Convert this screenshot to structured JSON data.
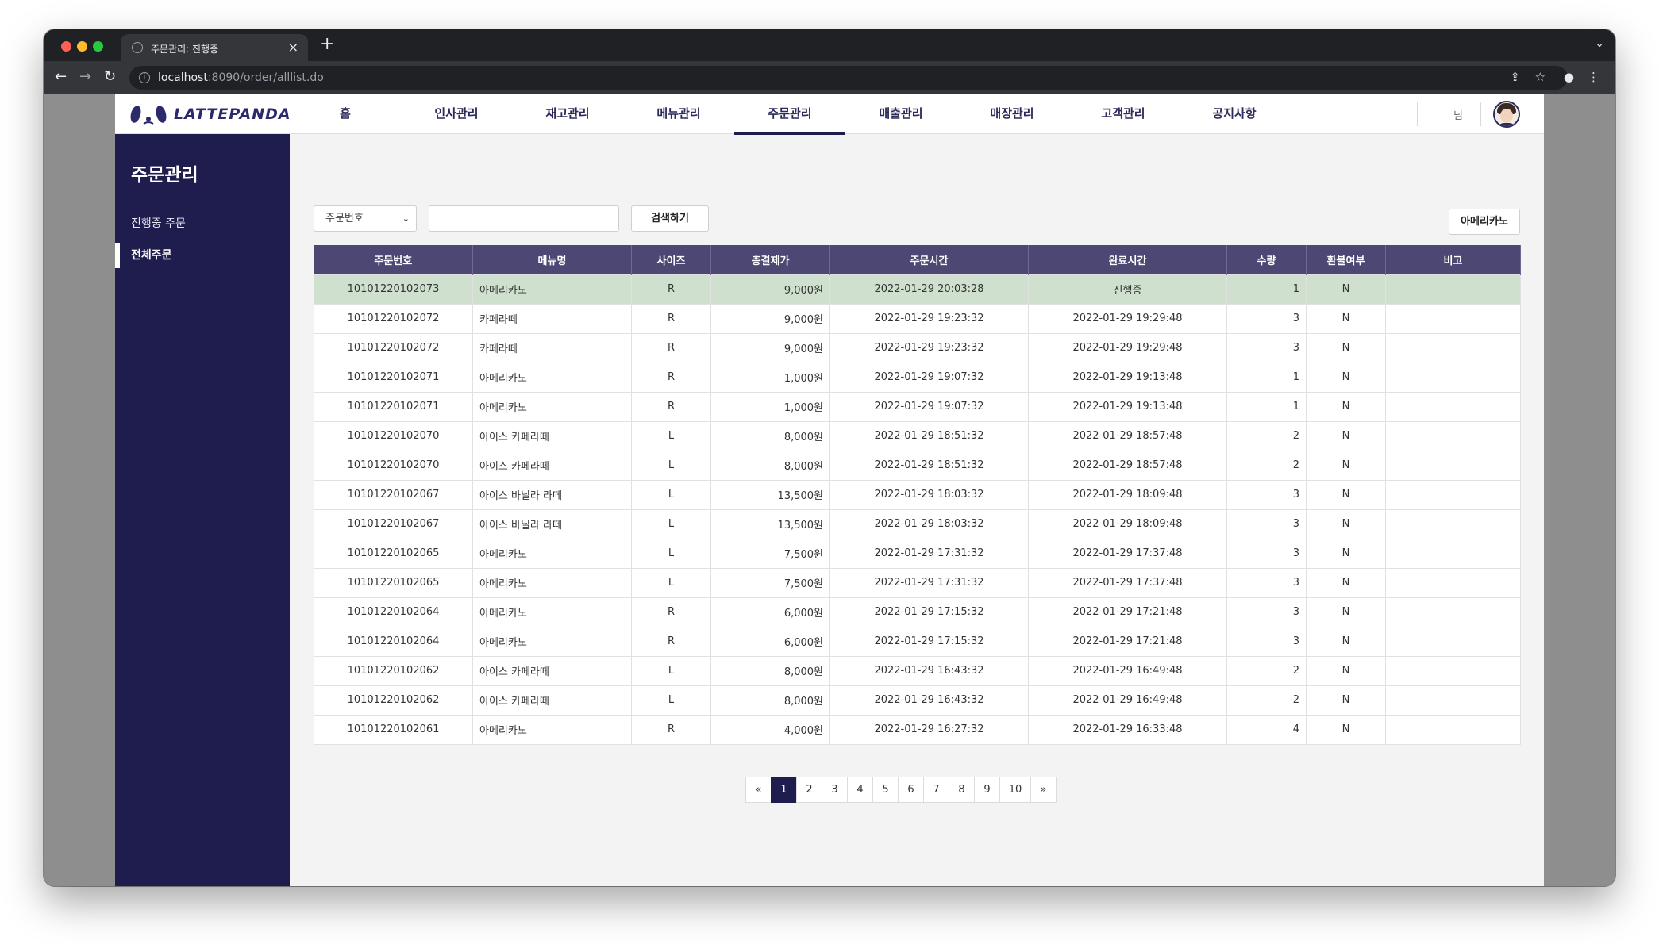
{
  "browser": {
    "tab_title": "주문관리: 진행중",
    "url_host": "localhost",
    "url_rest": ":8090/order/alllist.do"
  },
  "header": {
    "logo_text": "LATTEPANDA",
    "nav": [
      "홈",
      "인사관리",
      "재고관리",
      "메뉴관리",
      "주문관리",
      "매출관리",
      "매장관리",
      "고객관리",
      "공지사항"
    ],
    "active_nav": "주문관리",
    "user_suffix": "님"
  },
  "sidebar": {
    "title": "주문관리",
    "items": [
      "진행중 주문",
      "전체주문"
    ],
    "active_item": "전체주문"
  },
  "search": {
    "select_value": "주문번호",
    "input_value": "",
    "search_button": "검색하기",
    "filter_button": "아메리카노"
  },
  "table": {
    "headers": [
      "주문번호",
      "메뉴명",
      "사이즈",
      "총결제가",
      "주문시간",
      "완료시간",
      "수량",
      "환불여부",
      "비고"
    ],
    "rows": [
      [
        "10101220102073",
        "아메리카노",
        "R",
        "9,000원",
        "2022-01-29 20:03:28",
        "진행중",
        "1",
        "N",
        ""
      ],
      [
        "10101220102072",
        "카페라떼",
        "R",
        "9,000원",
        "2022-01-29 19:23:32",
        "2022-01-29 19:29:48",
        "3",
        "N",
        ""
      ],
      [
        "10101220102072",
        "카페라떼",
        "R",
        "9,000원",
        "2022-01-29 19:23:32",
        "2022-01-29 19:29:48",
        "3",
        "N",
        ""
      ],
      [
        "10101220102071",
        "아메리카노",
        "R",
        "1,000원",
        "2022-01-29 19:07:32",
        "2022-01-29 19:13:48",
        "1",
        "N",
        ""
      ],
      [
        "10101220102071",
        "아메리카노",
        "R",
        "1,000원",
        "2022-01-29 19:07:32",
        "2022-01-29 19:13:48",
        "1",
        "N",
        ""
      ],
      [
        "10101220102070",
        "아이스 카페라떼",
        "L",
        "8,000원",
        "2022-01-29 18:51:32",
        "2022-01-29 18:57:48",
        "2",
        "N",
        ""
      ],
      [
        "10101220102070",
        "아이스 카페라떼",
        "L",
        "8,000원",
        "2022-01-29 18:51:32",
        "2022-01-29 18:57:48",
        "2",
        "N",
        ""
      ],
      [
        "10101220102067",
        "아이스 바닐라 라떼",
        "L",
        "13,500원",
        "2022-01-29 18:03:32",
        "2022-01-29 18:09:48",
        "3",
        "N",
        ""
      ],
      [
        "10101220102067",
        "아이스 바닐라 라떼",
        "L",
        "13,500원",
        "2022-01-29 18:03:32",
        "2022-01-29 18:09:48",
        "3",
        "N",
        ""
      ],
      [
        "10101220102065",
        "아메리카노",
        "L",
        "7,500원",
        "2022-01-29 17:31:32",
        "2022-01-29 17:37:48",
        "3",
        "N",
        ""
      ],
      [
        "10101220102065",
        "아메리카노",
        "L",
        "7,500원",
        "2022-01-29 17:31:32",
        "2022-01-29 17:37:48",
        "3",
        "N",
        ""
      ],
      [
        "10101220102064",
        "아메리카노",
        "R",
        "6,000원",
        "2022-01-29 17:15:32",
        "2022-01-29 17:21:48",
        "3",
        "N",
        ""
      ],
      [
        "10101220102064",
        "아메리카노",
        "R",
        "6,000원",
        "2022-01-29 17:15:32",
        "2022-01-29 17:21:48",
        "3",
        "N",
        ""
      ],
      [
        "10101220102062",
        "아이스 카페라떼",
        "L",
        "8,000원",
        "2022-01-29 16:43:32",
        "2022-01-29 16:49:48",
        "2",
        "N",
        ""
      ],
      [
        "10101220102062",
        "아이스 카페라떼",
        "L",
        "8,000원",
        "2022-01-29 16:43:32",
        "2022-01-29 16:49:48",
        "2",
        "N",
        ""
      ],
      [
        "10101220102061",
        "아메리카노",
        "R",
        "4,000원",
        "2022-01-29 16:27:32",
        "2022-01-29 16:33:48",
        "4",
        "N",
        ""
      ]
    ],
    "highlight_color": "#cfe0cf",
    "header_color": "#4c4873"
  },
  "pagination": {
    "prev": "«",
    "pages": [
      "1",
      "2",
      "3",
      "4",
      "5",
      "6",
      "7",
      "8",
      "9",
      "10"
    ],
    "next": "»",
    "current": "1"
  },
  "colors": {
    "brand_navy": "#1f1d4d",
    "page_bg": "#f3f3f3"
  }
}
